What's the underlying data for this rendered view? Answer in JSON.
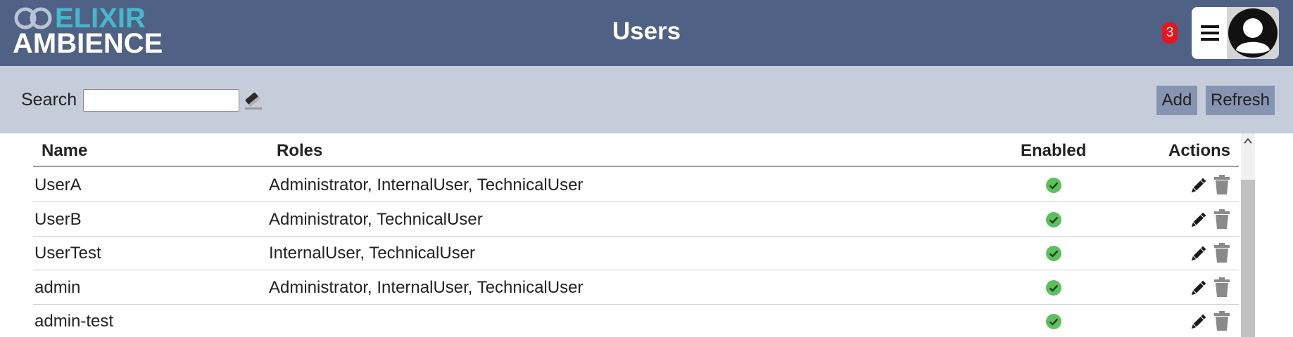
{
  "header": {
    "logo": {
      "line1": "ELIXIR",
      "line2": "AMBIENCE"
    },
    "title": "Users",
    "notification_count": "3",
    "icons": {
      "menu": "hamburger-menu-icon",
      "avatar": "user-avatar-icon"
    }
  },
  "toolbar": {
    "search_label": "Search",
    "search_value": "",
    "search_placeholder": "",
    "clear_icon": "eraser-icon",
    "add_label": "Add",
    "refresh_label": "Refresh"
  },
  "table": {
    "columns": {
      "name": "Name",
      "roles": "Roles",
      "enabled": "Enabled",
      "actions": "Actions"
    },
    "rows": [
      {
        "name": "UserA",
        "roles": "Administrator, InternalUser, TechnicalUser",
        "enabled": true
      },
      {
        "name": "UserB",
        "roles": "Administrator, TechnicalUser",
        "enabled": true
      },
      {
        "name": "UserTest",
        "roles": "InternalUser, TechnicalUser",
        "enabled": true
      },
      {
        "name": "admin",
        "roles": "Administrator, InternalUser, TechnicalUser",
        "enabled": true
      },
      {
        "name": "admin-test",
        "roles": "",
        "enabled": true
      }
    ],
    "action_icons": {
      "edit": "pencil-icon",
      "delete": "trash-icon",
      "enabled": "check-circle-icon"
    }
  },
  "colors": {
    "header_bg": "#4f6185",
    "toolbar_bg": "#c5cddb",
    "logo_accent": "#45b8cc",
    "badge": "#e8141c",
    "enabled_check": "#5cc05c",
    "button_bg": "#8794b1"
  }
}
